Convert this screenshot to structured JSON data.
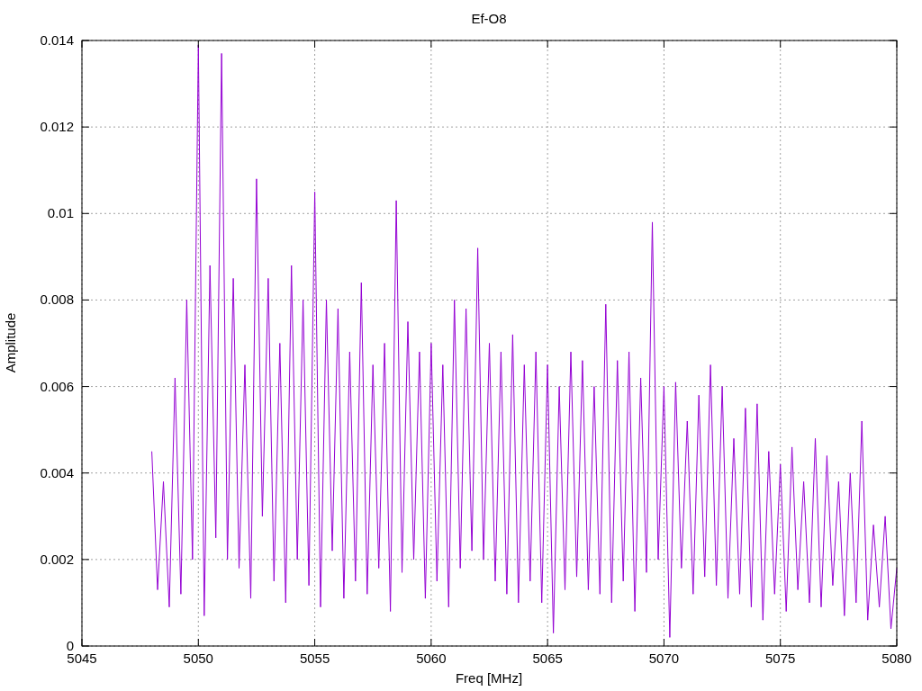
{
  "plot": {
    "chart_data": {
      "type": "line",
      "title": "Ef-O8",
      "xlabel": "Freq [MHz]",
      "ylabel": "Amplitude",
      "xlim": [
        5045,
        5080
      ],
      "ylim": [
        0,
        0.014
      ],
      "grid": true,
      "xticks": [
        5045,
        5050,
        5055,
        5060,
        5065,
        5070,
        5075,
        5080
      ],
      "yticks": [
        {
          "value": 0,
          "label": "0"
        },
        {
          "value": 0.002,
          "label": "0.002"
        },
        {
          "value": 0.004,
          "label": "0.004"
        },
        {
          "value": 0.006,
          "label": "0.006"
        },
        {
          "value": 0.008,
          "label": "0.008"
        },
        {
          "value": 0.01,
          "label": "0.01"
        },
        {
          "value": 0.012,
          "label": "0.012"
        },
        {
          "value": 0.014,
          "label": "0.014"
        }
      ],
      "x": [
        5048,
        5048.25,
        5048.5,
        5048.75,
        5049,
        5049.25,
        5049.5,
        5049.75,
        5050,
        5050.25,
        5050.5,
        5050.75,
        5051,
        5051.25,
        5051.5,
        5051.75,
        5052,
        5052.25,
        5052.5,
        5052.75,
        5053,
        5053.25,
        5053.5,
        5053.75,
        5054,
        5054.25,
        5054.5,
        5054.75,
        5055,
        5055.25,
        5055.5,
        5055.75,
        5056,
        5056.25,
        5056.5,
        5056.75,
        5057,
        5057.25,
        5057.5,
        5057.75,
        5058,
        5058.25,
        5058.5,
        5058.75,
        5059,
        5059.25,
        5059.5,
        5059.75,
        5060,
        5060.25,
        5060.5,
        5060.75,
        5061,
        5061.25,
        5061.5,
        5061.75,
        5062,
        5062.25,
        5062.5,
        5062.75,
        5063,
        5063.25,
        5063.5,
        5063.75,
        5064,
        5064.25,
        5064.5,
        5064.75,
        5065,
        5065.25,
        5065.5,
        5065.75,
        5066,
        5066.25,
        5066.5,
        5066.75,
        5067,
        5067.25,
        5067.5,
        5067.75,
        5068,
        5068.25,
        5068.5,
        5068.75,
        5069,
        5069.25,
        5069.5,
        5069.75,
        5070,
        5070.25,
        5070.5,
        5070.75,
        5071,
        5071.25,
        5071.5,
        5071.75,
        5072,
        5072.25,
        5072.5,
        5072.75,
        5073,
        5073.25,
        5073.5,
        5073.75,
        5074,
        5074.25,
        5074.5,
        5074.75,
        5075,
        5075.25,
        5075.5,
        5075.75,
        5076,
        5076.25,
        5076.5,
        5076.75,
        5077,
        5077.25,
        5077.5,
        5077.75,
        5078,
        5078.25,
        5078.5,
        5078.75,
        5079,
        5079.25,
        5079.5,
        5079.75,
        5080
      ],
      "series": [
        {
          "color": "#9400d3",
          "values": [
            0.0045,
            0.0013,
            0.0038,
            0.0009,
            0.0062,
            0.0012,
            0.008,
            0.002,
            0.0139,
            0.0007,
            0.0088,
            0.0025,
            0.0137,
            0.002,
            0.0085,
            0.0018,
            0.0065,
            0.0011,
            0.0108,
            0.003,
            0.0085,
            0.0015,
            0.007,
            0.001,
            0.0088,
            0.002,
            0.008,
            0.0014,
            0.0105,
            0.0009,
            0.008,
            0.0022,
            0.0078,
            0.0011,
            0.0068,
            0.0015,
            0.0084,
            0.0012,
            0.0065,
            0.0018,
            0.007,
            0.0008,
            0.0103,
            0.0017,
            0.0075,
            0.002,
            0.0068,
            0.0011,
            0.007,
            0.0015,
            0.0065,
            0.0009,
            0.008,
            0.0018,
            0.0078,
            0.0022,
            0.0092,
            0.002,
            0.007,
            0.0015,
            0.0068,
            0.0012,
            0.0072,
            0.001,
            0.0065,
            0.0015,
            0.0068,
            0.001,
            0.0065,
            0.0003,
            0.006,
            0.0013,
            0.0068,
            0.0016,
            0.0066,
            0.0013,
            0.006,
            0.0012,
            0.0079,
            0.001,
            0.0066,
            0.0015,
            0.0068,
            0.0008,
            0.0062,
            0.0017,
            0.0098,
            0.002,
            0.006,
            0.0002,
            0.0061,
            0.0018,
            0.0052,
            0.0012,
            0.0058,
            0.0016,
            0.0065,
            0.0014,
            0.006,
            0.0011,
            0.0048,
            0.0012,
            0.0055,
            0.0009,
            0.0056,
            0.0006,
            0.0045,
            0.0012,
            0.0042,
            0.0008,
            0.0046,
            0.0013,
            0.0038,
            0.001,
            0.0048,
            0.0009,
            0.0044,
            0.0014,
            0.0038,
            0.0007,
            0.004,
            0.001,
            0.0052,
            0.0006,
            0.0028,
            0.0009,
            0.003,
            0.0004,
            0.0018
          ]
        }
      ]
    }
  }
}
